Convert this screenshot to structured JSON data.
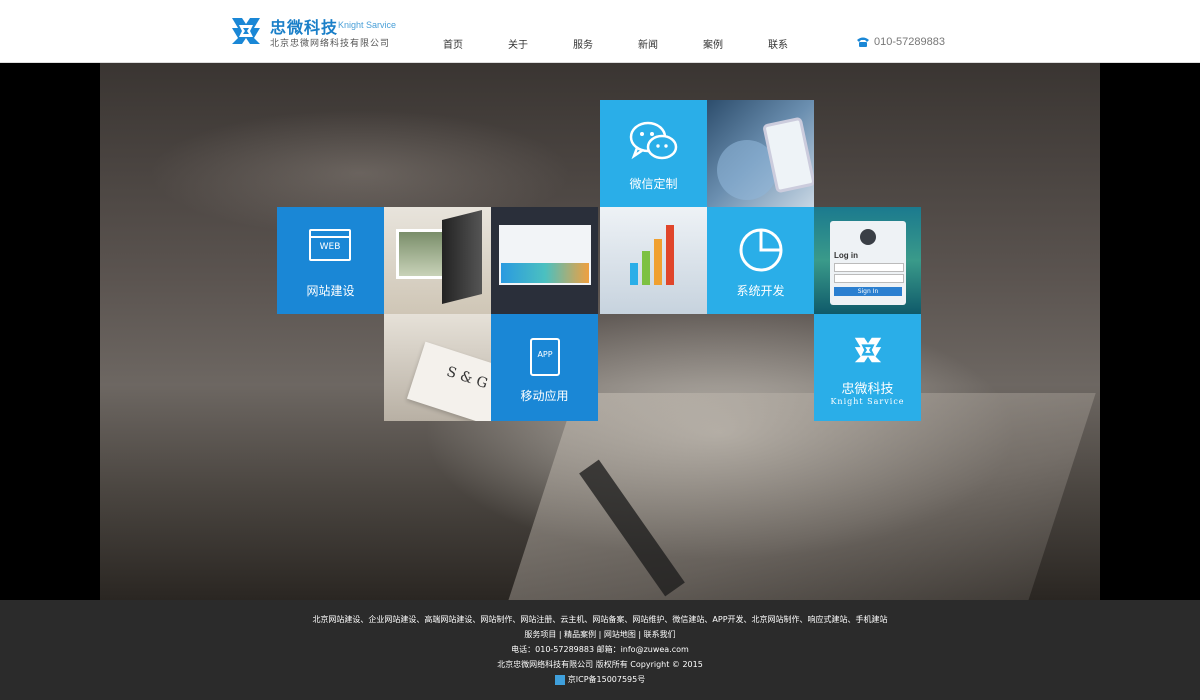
{
  "brand": {
    "name_cn": "忠微科技",
    "name_en": "Knight Sarvice",
    "company": "北京忠微网络科技有限公司",
    "logo_icon": "knight-logo-icon",
    "accent_color": "#1a87d6"
  },
  "nav": {
    "items": [
      {
        "label": "首页"
      },
      {
        "label": "关于"
      },
      {
        "label": "服务"
      },
      {
        "label": "新闻"
      },
      {
        "label": "案例"
      },
      {
        "label": "联系"
      }
    ]
  },
  "phone": {
    "icon": "phone-icon",
    "number": "010-57289883"
  },
  "tiles": {
    "wechat": {
      "label": "微信定制",
      "icon": "wechat-icon"
    },
    "web": {
      "label": "网站建设",
      "icon_text": "WEB",
      "icon": "browser-icon"
    },
    "system": {
      "label": "系统开发",
      "icon": "pie-chart-icon"
    },
    "app": {
      "label": "移动应用",
      "icon_text": "APP",
      "icon": "tablet-icon"
    },
    "brand": {
      "label": "忠微科技",
      "sub": "Knight Sarvice",
      "icon": "knight-logo-icon"
    },
    "login_card": {
      "title": "Log in",
      "button": "Sign In"
    },
    "card_text": "S & G"
  },
  "footer": {
    "services": "北京网站建设、企业网站建设、高端网站建设、网站制作、网站注册、云主机、网站备案、网站维护、微信建站、APP开发、北京网站制作、响应式建站、手机建站",
    "links": "服务项目 | 精品案例 | 网站地图 | 联系我们",
    "contact": "电话：010-57289883    邮箱：info@zuwea.com",
    "copyright": "北京忠微网络科技有限公司 版权所有 Copyright © 2015",
    "icp": "京ICP备15007595号"
  }
}
